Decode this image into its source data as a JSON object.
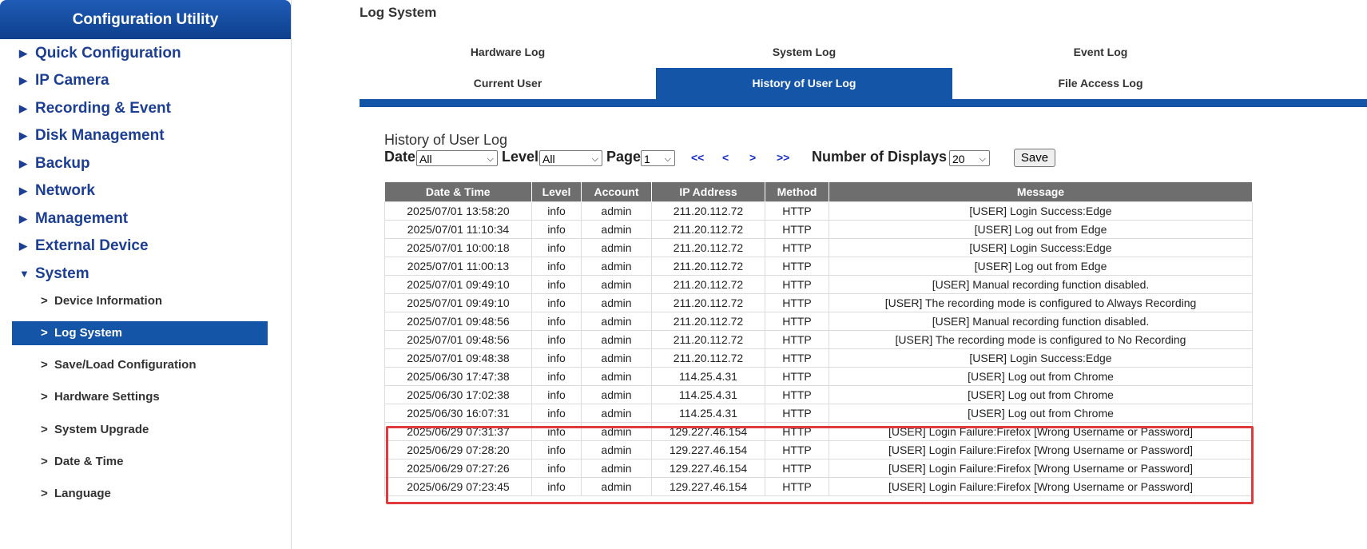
{
  "sidebar": {
    "title": "Configuration Utility",
    "menu": [
      {
        "label": "Quick Configuration",
        "expanded": false
      },
      {
        "label": "IP Camera",
        "expanded": false
      },
      {
        "label": "Recording & Event",
        "expanded": false
      },
      {
        "label": "Disk Management",
        "expanded": false
      },
      {
        "label": "Backup",
        "expanded": false
      },
      {
        "label": "Network",
        "expanded": false
      },
      {
        "label": "Management",
        "expanded": false
      },
      {
        "label": "External Device",
        "expanded": false
      },
      {
        "label": "System",
        "expanded": true
      }
    ],
    "submenu": [
      {
        "label": "Device Information"
      },
      {
        "label": "Log System",
        "active": true
      },
      {
        "label": "Save/Load Configuration"
      },
      {
        "label": "Hardware Settings"
      },
      {
        "label": "System Upgrade"
      },
      {
        "label": "Date & Time"
      },
      {
        "label": "Language"
      }
    ],
    "submenu_marker": ">",
    "arrow_collapsed": "▶",
    "arrow_expanded": "▼"
  },
  "page_title": "Log System",
  "tabs": {
    "row1": [
      "Hardware Log",
      "System Log",
      "Event Log"
    ],
    "row2": [
      "Current User",
      "History of User Log",
      "File Access Log"
    ],
    "active": "History of User Log"
  },
  "section_title": "History of User Log",
  "controls": {
    "date_label": "Date",
    "date_value": "All",
    "level_label": "Level",
    "level_value": "All",
    "page_label": "Page",
    "page_value": "1",
    "first": "<<",
    "prev": "<",
    "next": ">",
    "last": ">>",
    "displays_label": "Number of Displays",
    "displays_value": "20",
    "save_label": "Save"
  },
  "table": {
    "columns": [
      "Date & Time",
      "Level",
      "Account",
      "IP Address",
      "Method",
      "Message"
    ],
    "rows": [
      [
        "2025/07/01 13:58:20",
        "info",
        "admin",
        "211.20.112.72",
        "HTTP",
        "[USER] Login Success:Edge"
      ],
      [
        "2025/07/01 11:10:34",
        "info",
        "admin",
        "211.20.112.72",
        "HTTP",
        "[USER] Log out from Edge"
      ],
      [
        "2025/07/01 10:00:18",
        "info",
        "admin",
        "211.20.112.72",
        "HTTP",
        "[USER] Login Success:Edge"
      ],
      [
        "2025/07/01 11:00:13",
        "info",
        "admin",
        "211.20.112.72",
        "HTTP",
        "[USER] Log out from Edge"
      ],
      [
        "2025/07/01 09:49:10",
        "info",
        "admin",
        "211.20.112.72",
        "HTTP",
        "[USER] Manual recording function disabled."
      ],
      [
        "2025/07/01 09:49:10",
        "info",
        "admin",
        "211.20.112.72",
        "HTTP",
        "[USER] The recording mode is configured to Always Recording"
      ],
      [
        "2025/07/01 09:48:56",
        "info",
        "admin",
        "211.20.112.72",
        "HTTP",
        "[USER] Manual recording function disabled."
      ],
      [
        "2025/07/01 09:48:56",
        "info",
        "admin",
        "211.20.112.72",
        "HTTP",
        "[USER] The recording mode is configured to No Recording"
      ],
      [
        "2025/07/01 09:48:38",
        "info",
        "admin",
        "211.20.112.72",
        "HTTP",
        "[USER] Login Success:Edge"
      ],
      [
        "2025/06/30 17:47:38",
        "info",
        "admin",
        "114.25.4.31",
        "HTTP",
        "[USER] Log out from Chrome"
      ],
      [
        "2025/06/30 17:02:38",
        "info",
        "admin",
        "114.25.4.31",
        "HTTP",
        "[USER] Log out from Chrome"
      ],
      [
        "2025/06/30 16:07:31",
        "info",
        "admin",
        "114.25.4.31",
        "HTTP",
        "[USER] Log out from Chrome"
      ],
      [
        "2025/06/29 07:31:37",
        "info",
        "admin",
        "129.227.46.154",
        "HTTP",
        "[USER] Login Failure:Firefox [Wrong Username or Password]"
      ],
      [
        "2025/06/29 07:28:20",
        "info",
        "admin",
        "129.227.46.154",
        "HTTP",
        "[USER] Login Failure:Firefox [Wrong Username or Password]"
      ],
      [
        "2025/06/29 07:27:26",
        "info",
        "admin",
        "129.227.46.154",
        "HTTP",
        "[USER] Login Failure:Firefox [Wrong Username or Password]"
      ],
      [
        "2025/06/29 07:23:45",
        "info",
        "admin",
        "129.227.46.154",
        "HTTP",
        "[USER] Login Failure:Firefox [Wrong Username or Password]"
      ]
    ]
  },
  "colors": {
    "brand": "#1555a8",
    "highlight": "#e0393e",
    "header_bg": "#6e6e6e"
  }
}
